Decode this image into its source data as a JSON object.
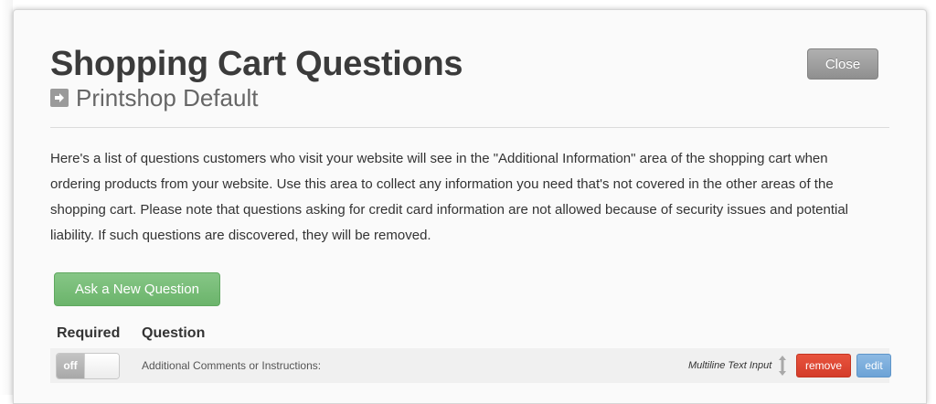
{
  "modal": {
    "title": "Shopping Cart Questions",
    "subtitle": "Printshop Default",
    "close_label": "Close",
    "description": "Here's a list of questions customers who visit your website will see in the \"Additional Information\" area of the shopping cart when ordering products from your website. Use this area to collect any information you need that's not covered in the other areas of the shopping cart. Please note that questions asking for credit card information are not allowed because of security issues and potential liability. If such questions are discovered, they will be removed.",
    "ask_button_label": "Ask a New Question"
  },
  "table": {
    "headers": {
      "required": "Required",
      "question": "Question"
    },
    "rows": [
      {
        "required_toggle": "off",
        "question": "Additional Comments or Instructions:",
        "type": "Multiline Text Input",
        "remove_label": "remove",
        "edit_label": "edit"
      }
    ]
  },
  "icons": {
    "subtitle_icon": "arrow-right-icon",
    "reorder_icon": "drag-handle-icon"
  },
  "colors": {
    "ask_button": "#6bb46b",
    "remove_button": "#d43c2a",
    "edit_button": "#6da3d6",
    "close_button": "#9a9a9a"
  }
}
